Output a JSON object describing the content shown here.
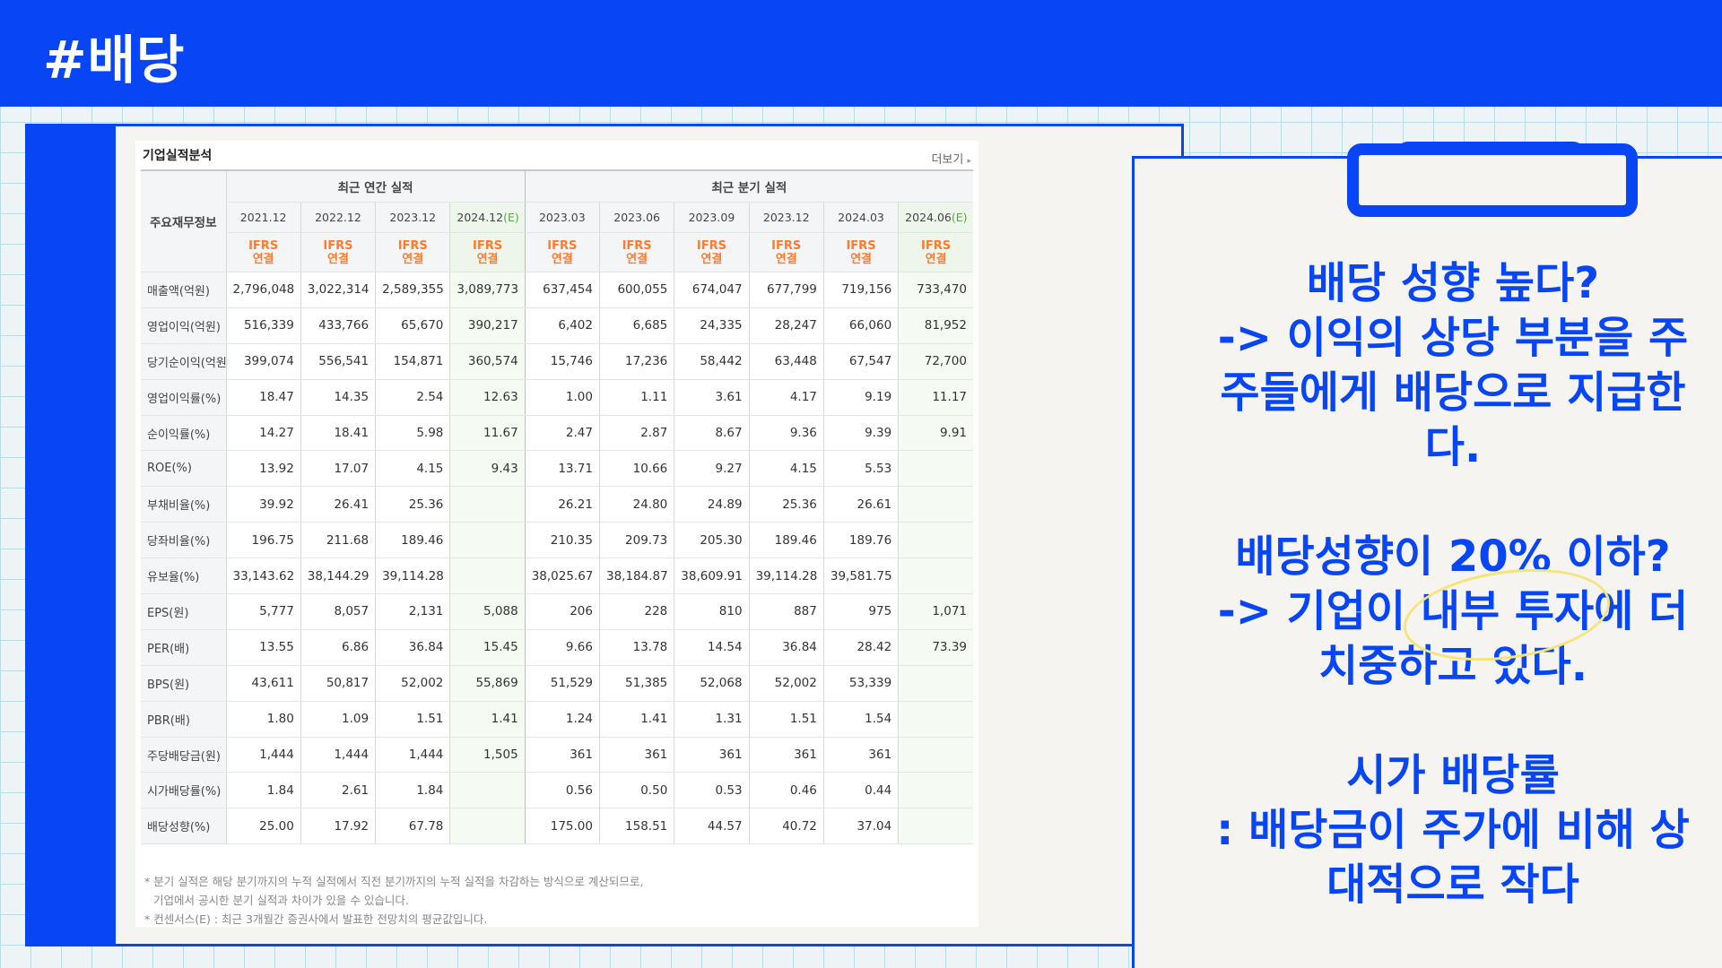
{
  "header": {
    "title": "#배당"
  },
  "screenshot": {
    "title": "기업실적분석",
    "more_label": "더보기",
    "row_header_label": "주요재무정보",
    "group_annual": "최근 연간 실적",
    "group_quarter": "최근 분기 실적",
    "columns": [
      {
        "period": "2021.12",
        "est": ""
      },
      {
        "period": "2022.12",
        "est": ""
      },
      {
        "period": "2023.12",
        "est": ""
      },
      {
        "period": "2024.12",
        "est": "(E)"
      },
      {
        "period": "2023.03",
        "est": ""
      },
      {
        "period": "2023.06",
        "est": ""
      },
      {
        "period": "2023.09",
        "est": ""
      },
      {
        "period": "2023.12",
        "est": ""
      },
      {
        "period": "2024.03",
        "est": ""
      },
      {
        "period": "2024.06",
        "est": "(E)"
      }
    ],
    "ifrs_top": "IFRS",
    "ifrs_bottom": "연결",
    "rows": [
      {
        "label": "매출액(억원)",
        "values": [
          "2,796,048",
          "3,022,314",
          "2,589,355",
          "3,089,773",
          "637,454",
          "600,055",
          "674,047",
          "677,799",
          "719,156",
          "733,470"
        ]
      },
      {
        "label": "영업이익(억원)",
        "values": [
          "516,339",
          "433,766",
          "65,670",
          "390,217",
          "6,402",
          "6,685",
          "24,335",
          "28,247",
          "66,060",
          "81,952"
        ]
      },
      {
        "label": "당기순이익(억원)",
        "values": [
          "399,074",
          "556,541",
          "154,871",
          "360,574",
          "15,746",
          "17,236",
          "58,442",
          "63,448",
          "67,547",
          "72,700"
        ]
      },
      {
        "label": "영업이익률(%)",
        "values": [
          "18.47",
          "14.35",
          "2.54",
          "12.63",
          "1.00",
          "1.11",
          "3.61",
          "4.17",
          "9.19",
          "11.17"
        ]
      },
      {
        "label": "순이익률(%)",
        "values": [
          "14.27",
          "18.41",
          "5.98",
          "11.67",
          "2.47",
          "2.87",
          "8.67",
          "9.36",
          "9.39",
          "9.91"
        ]
      },
      {
        "label": "ROE(%)",
        "values": [
          "13.92",
          "17.07",
          "4.15",
          "9.43",
          "13.71",
          "10.66",
          "9.27",
          "4.15",
          "5.53",
          ""
        ]
      },
      {
        "label": "부채비율(%)",
        "values": [
          "39.92",
          "26.41",
          "25.36",
          "",
          "26.21",
          "24.80",
          "24.89",
          "25.36",
          "26.61",
          ""
        ]
      },
      {
        "label": "당좌비율(%)",
        "values": [
          "196.75",
          "211.68",
          "189.46",
          "",
          "210.35",
          "209.73",
          "205.30",
          "189.46",
          "189.76",
          ""
        ]
      },
      {
        "label": "유보율(%)",
        "values": [
          "33,143.62",
          "38,144.29",
          "39,114.28",
          "",
          "38,025.67",
          "38,184.87",
          "38,609.91",
          "39,114.28",
          "39,581.75",
          ""
        ]
      },
      {
        "label": "EPS(원)",
        "values": [
          "5,777",
          "8,057",
          "2,131",
          "5,088",
          "206",
          "228",
          "810",
          "887",
          "975",
          "1,071"
        ]
      },
      {
        "label": "PER(배)",
        "values": [
          "13.55",
          "6.86",
          "36.84",
          "15.45",
          "9.66",
          "13.78",
          "14.54",
          "36.84",
          "28.42",
          "73.39"
        ]
      },
      {
        "label": "BPS(원)",
        "values": [
          "43,611",
          "50,817",
          "52,002",
          "55,869",
          "51,529",
          "51,385",
          "52,068",
          "52,002",
          "53,339",
          ""
        ]
      },
      {
        "label": "PBR(배)",
        "values": [
          "1.80",
          "1.09",
          "1.51",
          "1.41",
          "1.24",
          "1.41",
          "1.31",
          "1.51",
          "1.54",
          ""
        ]
      },
      {
        "label": "주당배당금(원)",
        "values": [
          "1,444",
          "1,444",
          "1,444",
          "1,505",
          "361",
          "361",
          "361",
          "361",
          "361",
          ""
        ]
      },
      {
        "label": "시가배당률(%)",
        "values": [
          "1.84",
          "2.61",
          "1.84",
          "",
          "0.56",
          "0.50",
          "0.53",
          "0.46",
          "0.44",
          ""
        ]
      },
      {
        "label": "배당성향(%)",
        "values": [
          "25.00",
          "17.92",
          "67.78",
          "",
          "175.00",
          "158.51",
          "44.57",
          "40.72",
          "37.04",
          ""
        ]
      }
    ],
    "notes": [
      "* 분기 실적은 해당 분기까지의 누적 실적에서 직전 분기까지의 누적 실적을 차감하는 방식으로 계산되므로,",
      "기업에서 공시한 분기 실적과 차이가 있을 수 있습니다.",
      "* 컨센서스(E) : 최근 3개월간 증권사에서 발표한 전망치의 평균값입니다."
    ]
  },
  "card": {
    "lines": [
      "배당 성향 높다?",
      "-> 이익의 상당 부분을 주",
      "주들에게 배당으로 지급한",
      "다.",
      "",
      "배당성향이 20% 이하?",
      "-> 기업이 내부 투자에 더",
      "치중하고 있다.",
      "",
      "시가 배당률",
      ": 배당금이 주가에 비해 상",
      "대적으로 작다"
    ]
  },
  "colors": {
    "accent": "#0846f5",
    "ifrs": "#ff7a2b",
    "estimate": "#5aa84a",
    "highlight": "#f5e478"
  }
}
